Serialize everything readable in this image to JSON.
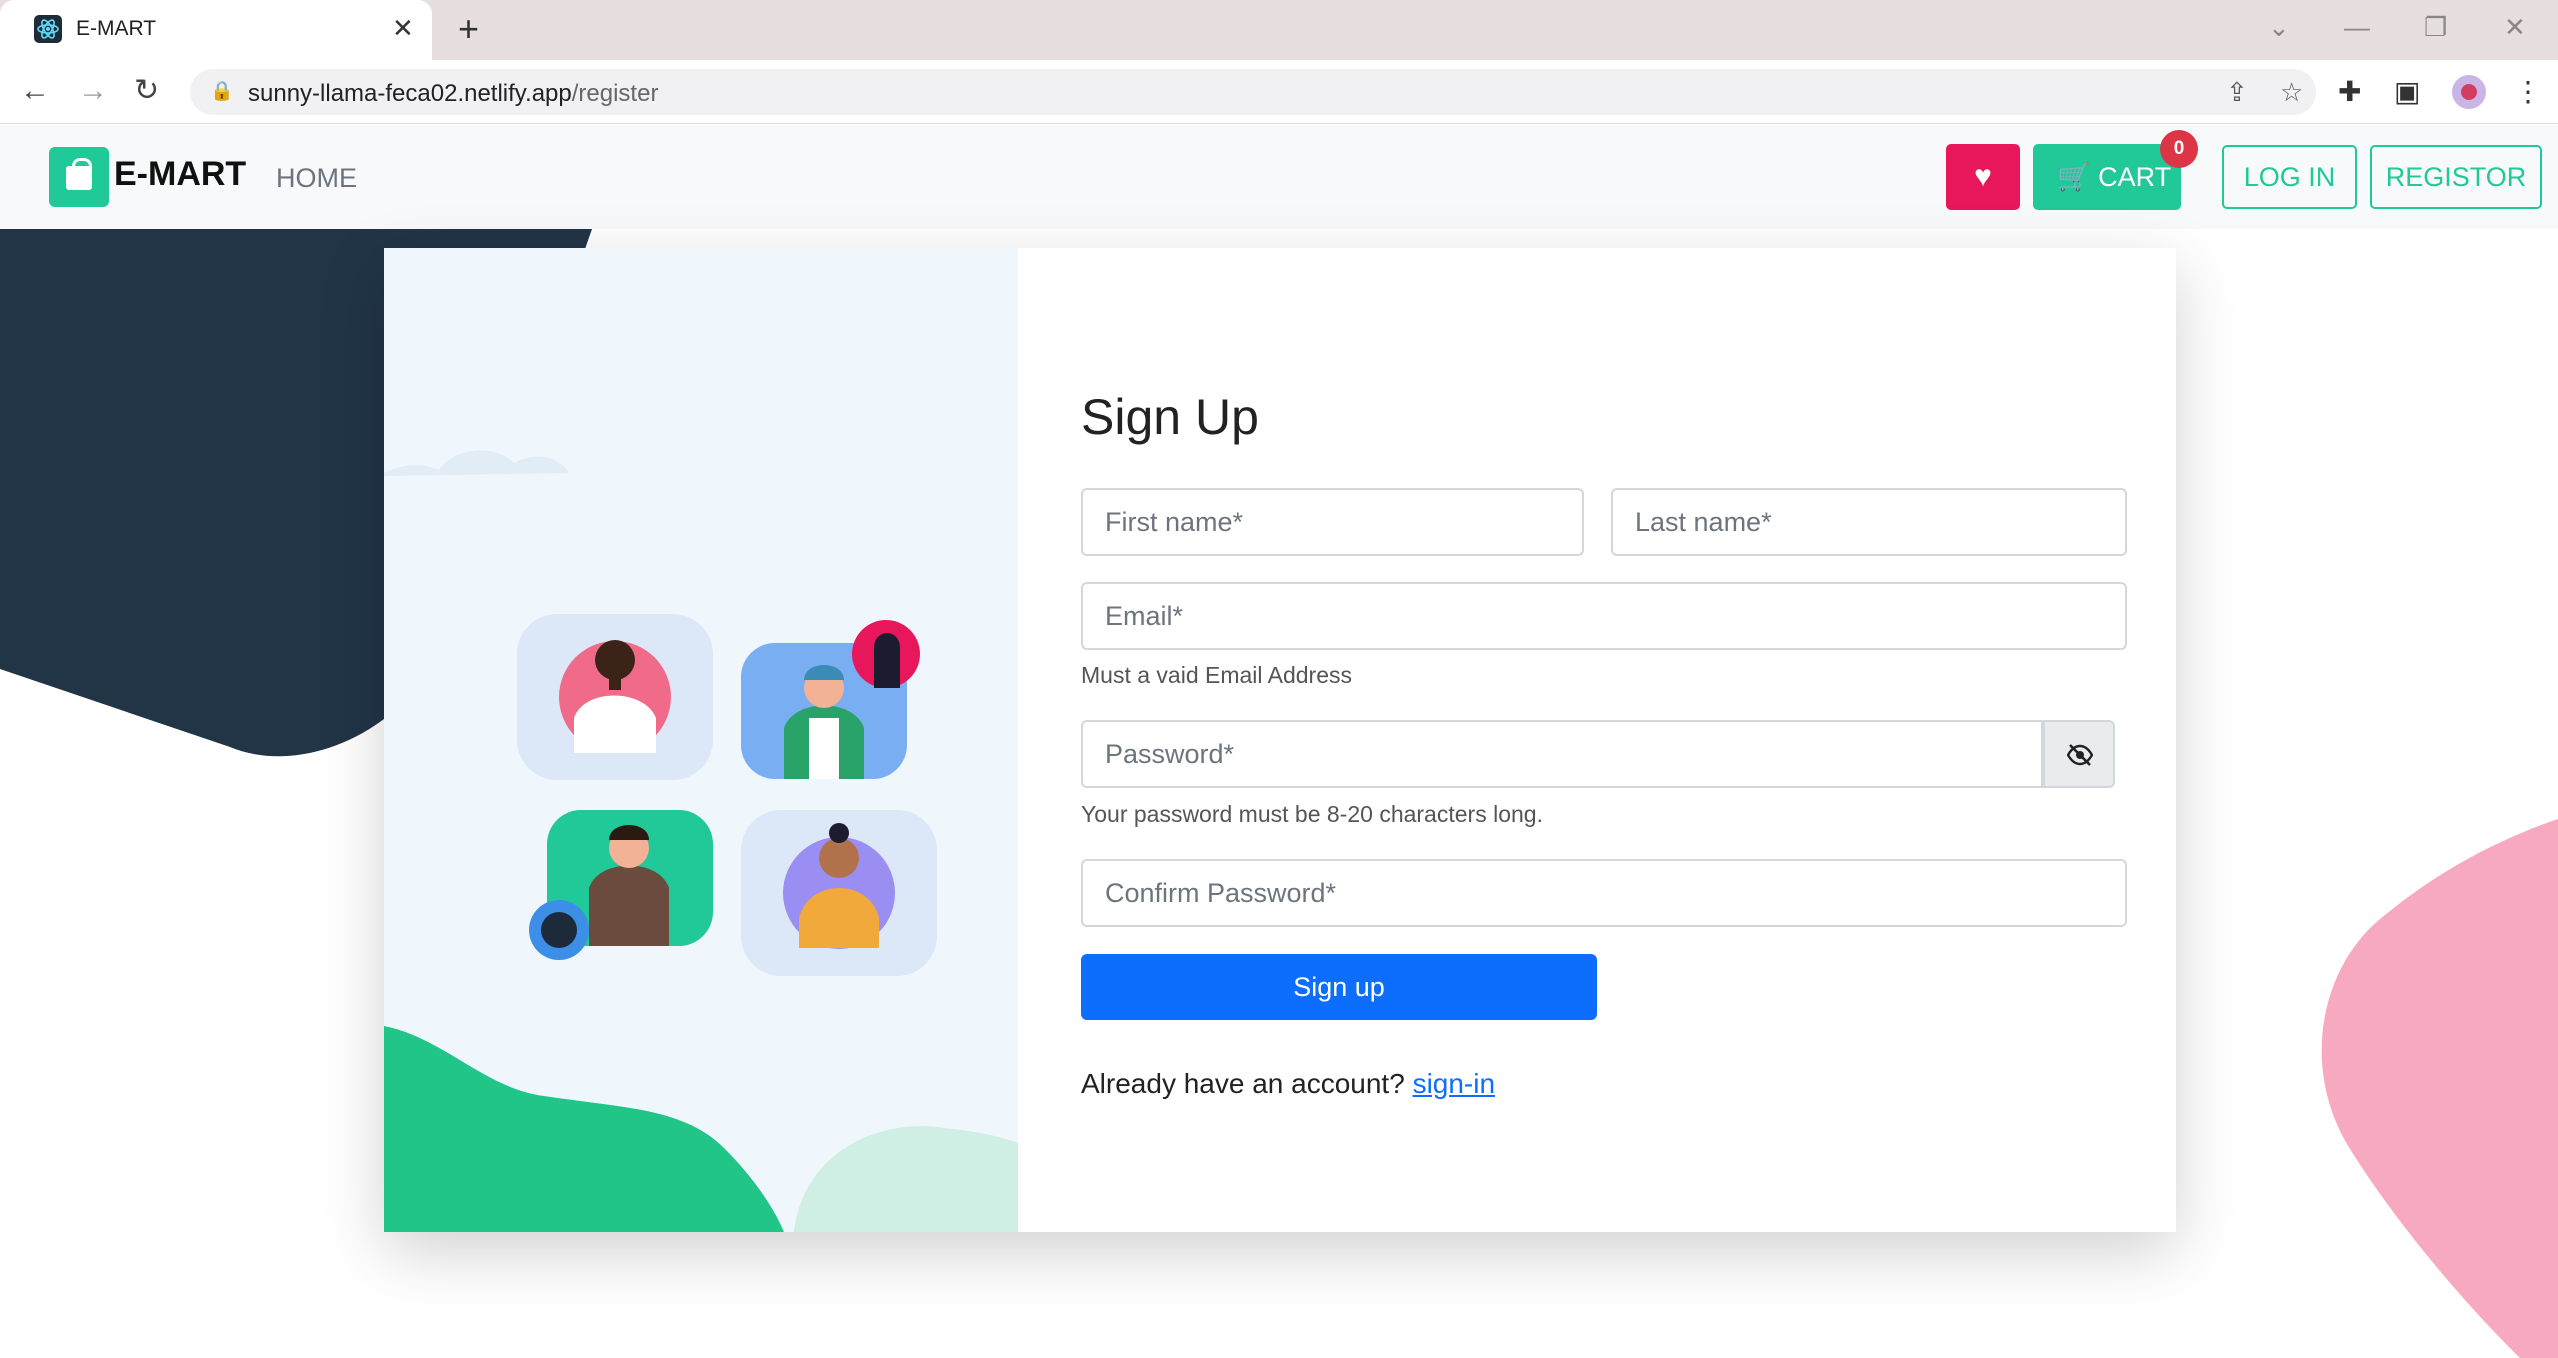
{
  "browser": {
    "tab_title": "E-MART",
    "url_host": "sunny-llama-feca02.netlify.app",
    "url_path": "/register"
  },
  "navbar": {
    "brand": "E-MART",
    "home": "HOME",
    "cart_label": "CART",
    "cart_count": "0",
    "login": "LOG IN",
    "register": "REGISTOR"
  },
  "form": {
    "title": "Sign Up",
    "first_name_placeholder": "First name*",
    "last_name_placeholder": "Last name*",
    "email_placeholder": "Email*",
    "email_help": "Must a vaid Email Address",
    "password_placeholder": "Password*",
    "password_help": "Your password must be 8-20 characters long.",
    "confirm_placeholder": "Confirm Password*",
    "submit": "Sign up",
    "have_account": "Already have an account?",
    "signin_link": "sign-in"
  },
  "colors": {
    "brand": "#20c997",
    "heart": "#e8175c",
    "primary": "#0d6efd",
    "badge": "#dc3545",
    "dark_shape": "#213547",
    "pink_shape": "#f7a9bf"
  }
}
